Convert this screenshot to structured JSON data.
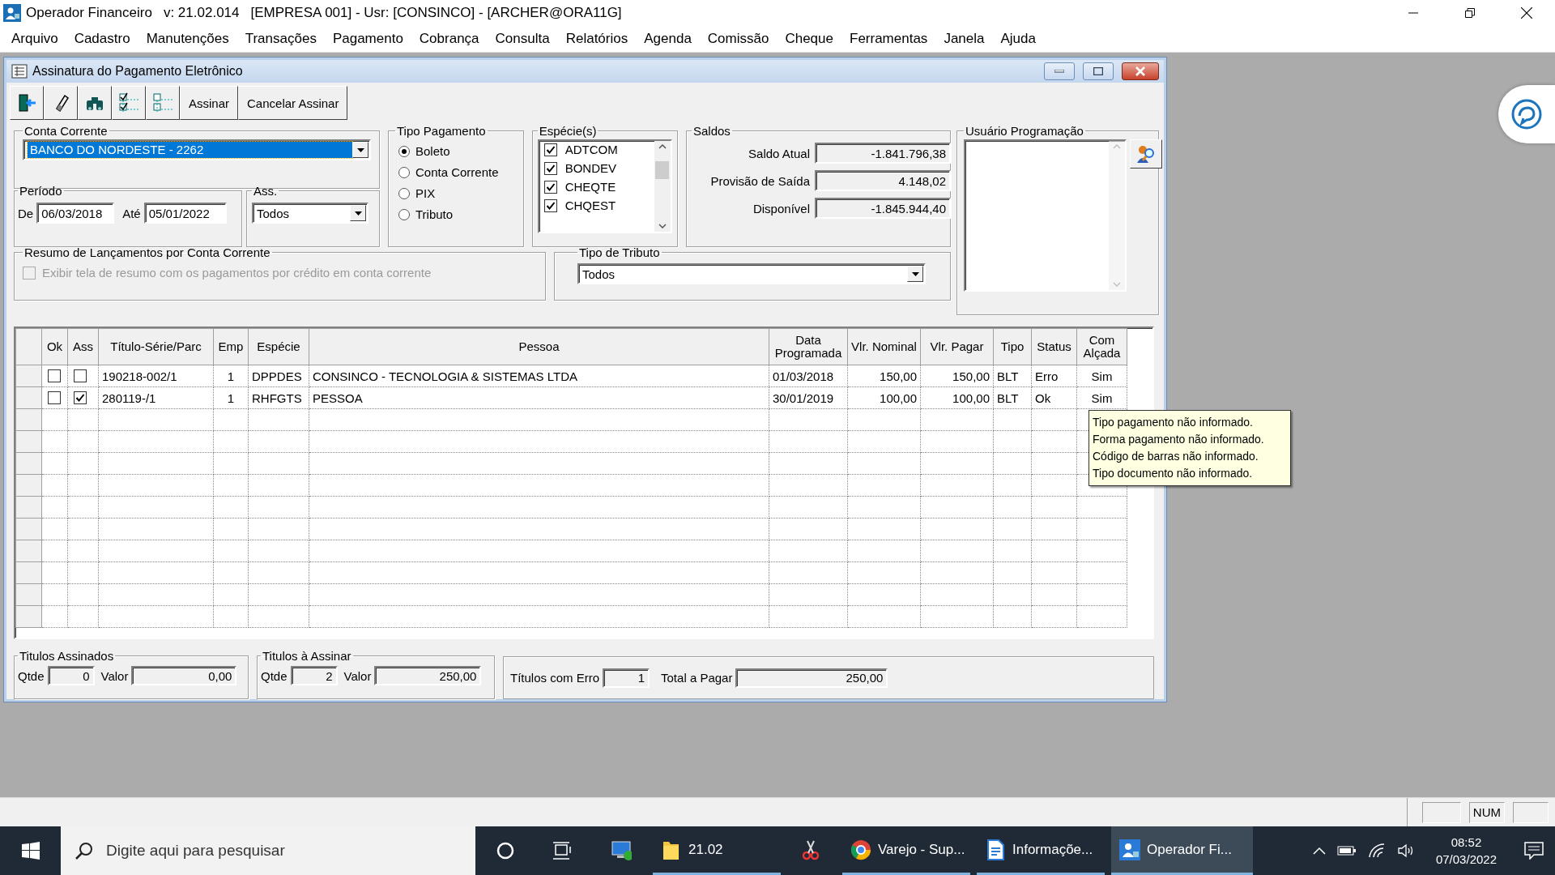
{
  "app": {
    "title_parts": [
      "Operador Financeiro",
      "v: 21.02.014",
      "[EMPRESA 001] - Usr: [CONSINCO] - [ARCHER@ORA11G]"
    ]
  },
  "menu": [
    "Arquivo",
    "Cadastro",
    "Manutenções",
    "Transações",
    "Pagamento",
    "Cobrança",
    "Consulta",
    "Relatórios",
    "Agenda",
    "Comissão",
    "Cheque",
    "Ferramentas",
    "Janela",
    "Ajuda"
  ],
  "window": {
    "title": "Assinatura do Pagamento Eletrônico",
    "text_buttons": [
      "Assinar",
      "Cancelar Assinar"
    ]
  },
  "conta_corrente": {
    "label": "Conta Corrente",
    "value": "BANCO DO NORDESTE - 2262"
  },
  "periodo": {
    "label": "Período",
    "de_label": "De",
    "de": "06/03/2018",
    "ate_label": "Até",
    "ate": "05/01/2022"
  },
  "ass": {
    "label": "Ass.",
    "value": "Todos"
  },
  "tipo_pagamento": {
    "label": "Tipo Pagamento",
    "options": [
      {
        "label": "Boleto",
        "selected": true
      },
      {
        "label": "Conta Corrente",
        "selected": false
      },
      {
        "label": "PIX",
        "selected": false
      },
      {
        "label": "Tributo",
        "selected": false
      }
    ]
  },
  "especies": {
    "label": "Espécie(s)",
    "items": [
      {
        "label": "ADTCOM",
        "checked": true
      },
      {
        "label": "BONDEV",
        "checked": true
      },
      {
        "label": "CHEQTE",
        "checked": true
      },
      {
        "label": "CHQEST",
        "checked": true
      }
    ]
  },
  "saldos": {
    "label": "Saldos",
    "rows": [
      {
        "label": "Saldo Atual",
        "value": "-1.841.796,38"
      },
      {
        "label": "Provisão de Saída",
        "value": "4.148,02"
      },
      {
        "label": "Disponível",
        "value": "-1.845.944,40"
      }
    ]
  },
  "usuario_programacao": {
    "label": "Usuário Programação"
  },
  "resumo": {
    "label": "Resumo de Lançamentos por Conta Corrente",
    "checkbox": {
      "label": "Exibir tela de resumo com os pagamentos por crédito em conta corrente",
      "checked": false,
      "disabled": true
    }
  },
  "tipo_tributo": {
    "label": "Tipo de Tributo",
    "value": "Todos"
  },
  "table": {
    "columns": [
      "Ok",
      "Ass",
      "Título-Série/Parc",
      "Emp",
      "Espécie",
      "Pessoa",
      "Data Programada",
      "Vlr. Nominal",
      "Vlr. Pagar",
      "Tipo",
      "Status",
      "Com Alçada"
    ],
    "rows": [
      {
        "cells": [
          {
            "checked": false
          },
          {
            "checked": false
          },
          "190218-002/1",
          "1",
          "DPPDES",
          "CONSINCO - TECNOLOGIA & SISTEMAS LTDA",
          "01/03/2018",
          "150,00",
          "150,00",
          "BLT",
          "Erro",
          "Sim"
        ]
      },
      {
        "cells": [
          {
            "checked": false
          },
          {
            "checked": true
          },
          "280119-/1",
          "1",
          "RHFGTS",
          "PESSOA",
          "30/01/2019",
          "100,00",
          "100,00",
          "BLT",
          "Ok",
          "Sim"
        ]
      }
    ]
  },
  "tooltip": {
    "lines": [
      "Tipo pagamento não informado.",
      "Forma pagamento não informado.",
      "Código de barras não informado.",
      "Tipo documento não informado."
    ]
  },
  "totals": {
    "assinados": {
      "label": "Titulos Assinados",
      "qtde_label": "Qtde",
      "qtde": "0",
      "valor_label": "Valor",
      "valor": "0,00"
    },
    "a_assinar": {
      "label": "Titulos à Assinar",
      "qtde_label": "Qtde",
      "qtde": "2",
      "valor_label": "Valor",
      "valor": "250,00"
    },
    "erro_label": "Títulos com Erro",
    "erro": "1",
    "total_label": "Total a Pagar",
    "total": "250,00"
  },
  "status_bar": {
    "num": "NUM"
  },
  "taskbar": {
    "search_placeholder": "Digite aqui para pesquisar",
    "apps": [
      {
        "kind": "remote",
        "open": false,
        "active": false
      },
      {
        "kind": "folder",
        "label": "21.02",
        "open": true,
        "active": false
      },
      {
        "kind": "snip",
        "open": false,
        "active": false
      },
      {
        "kind": "browser",
        "label": "Varejo - Sup...",
        "open": true,
        "active": false
      },
      {
        "kind": "document",
        "label": "Informaçõe...",
        "open": true,
        "active": false
      },
      {
        "kind": "operador",
        "label": "Operador Fi...",
        "open": true,
        "active": true
      }
    ],
    "time": "08:52",
    "date": "07/03/2022"
  }
}
